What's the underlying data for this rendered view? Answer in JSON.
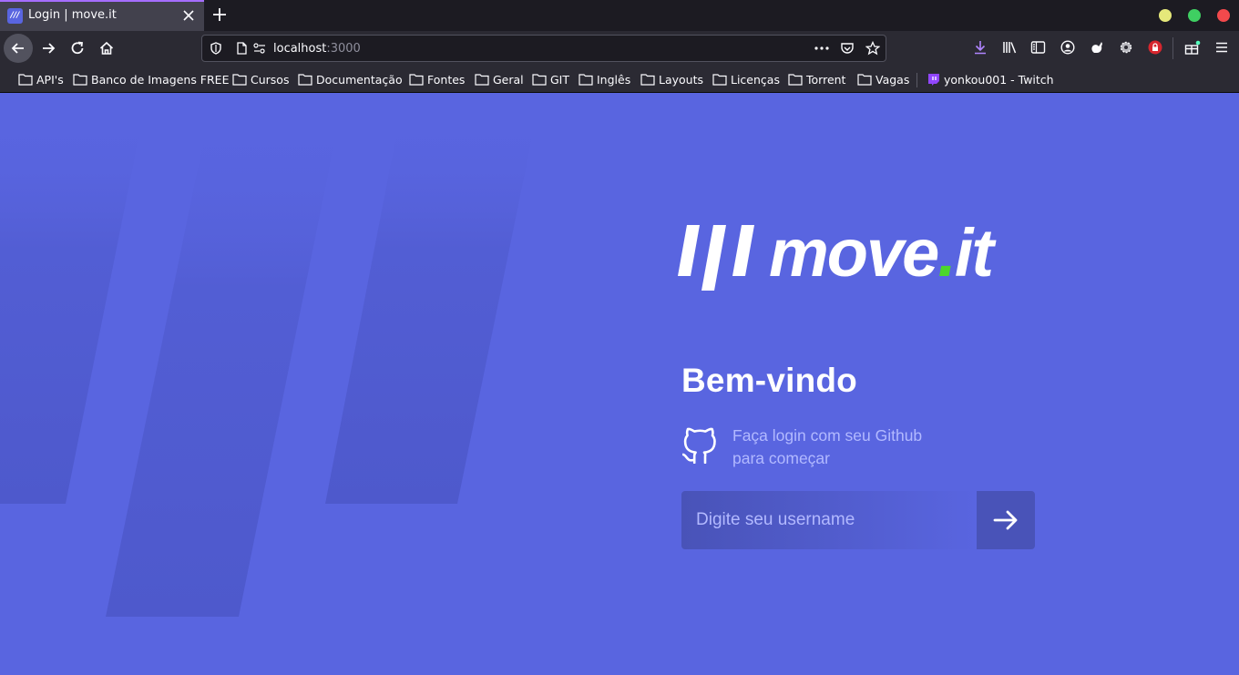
{
  "browser": {
    "tab": {
      "title": "Login | move.it",
      "favicon_text": "///"
    },
    "url": {
      "host": "localhost",
      "port": ":3000"
    },
    "window_controls": {
      "minimize_color": "#e5e87a",
      "maximize_color": "#3fcf62",
      "close_color": "#f2494c"
    },
    "bookmarks": [
      {
        "label": "API's",
        "icon": "folder-icon"
      },
      {
        "label": "Banco de Imagens FREE",
        "icon": "folder-icon"
      },
      {
        "label": "Cursos",
        "icon": "folder-icon"
      },
      {
        "label": "Documentação",
        "icon": "folder-icon"
      },
      {
        "label": "Fontes",
        "icon": "folder-icon"
      },
      {
        "label": "Geral",
        "icon": "folder-icon"
      },
      {
        "label": "GIT",
        "icon": "folder-icon"
      },
      {
        "label": "Inglês",
        "icon": "folder-icon"
      },
      {
        "label": "Layouts",
        "icon": "folder-icon"
      },
      {
        "label": "Licenças",
        "icon": "folder-icon"
      },
      {
        "label": "Torrent",
        "icon": "folder-icon"
      },
      {
        "label": "Vagas",
        "icon": "folder-icon"
      },
      {
        "label": "yonkou001 - Twitch",
        "icon": "twitch-icon"
      }
    ]
  },
  "page": {
    "logo": {
      "mark": "///",
      "word": "move",
      "dot": ".",
      "suffix": "it",
      "dot_color": "#4cd62b"
    },
    "heading": "Bem-vindo",
    "github_text_line1": "Faça login com seu Github",
    "github_text_line2": "para começar",
    "username_placeholder": "Digite seu username",
    "colors": {
      "background": "#5965e0",
      "text_light": "#b2b9ff",
      "button": "#4953b8"
    }
  }
}
